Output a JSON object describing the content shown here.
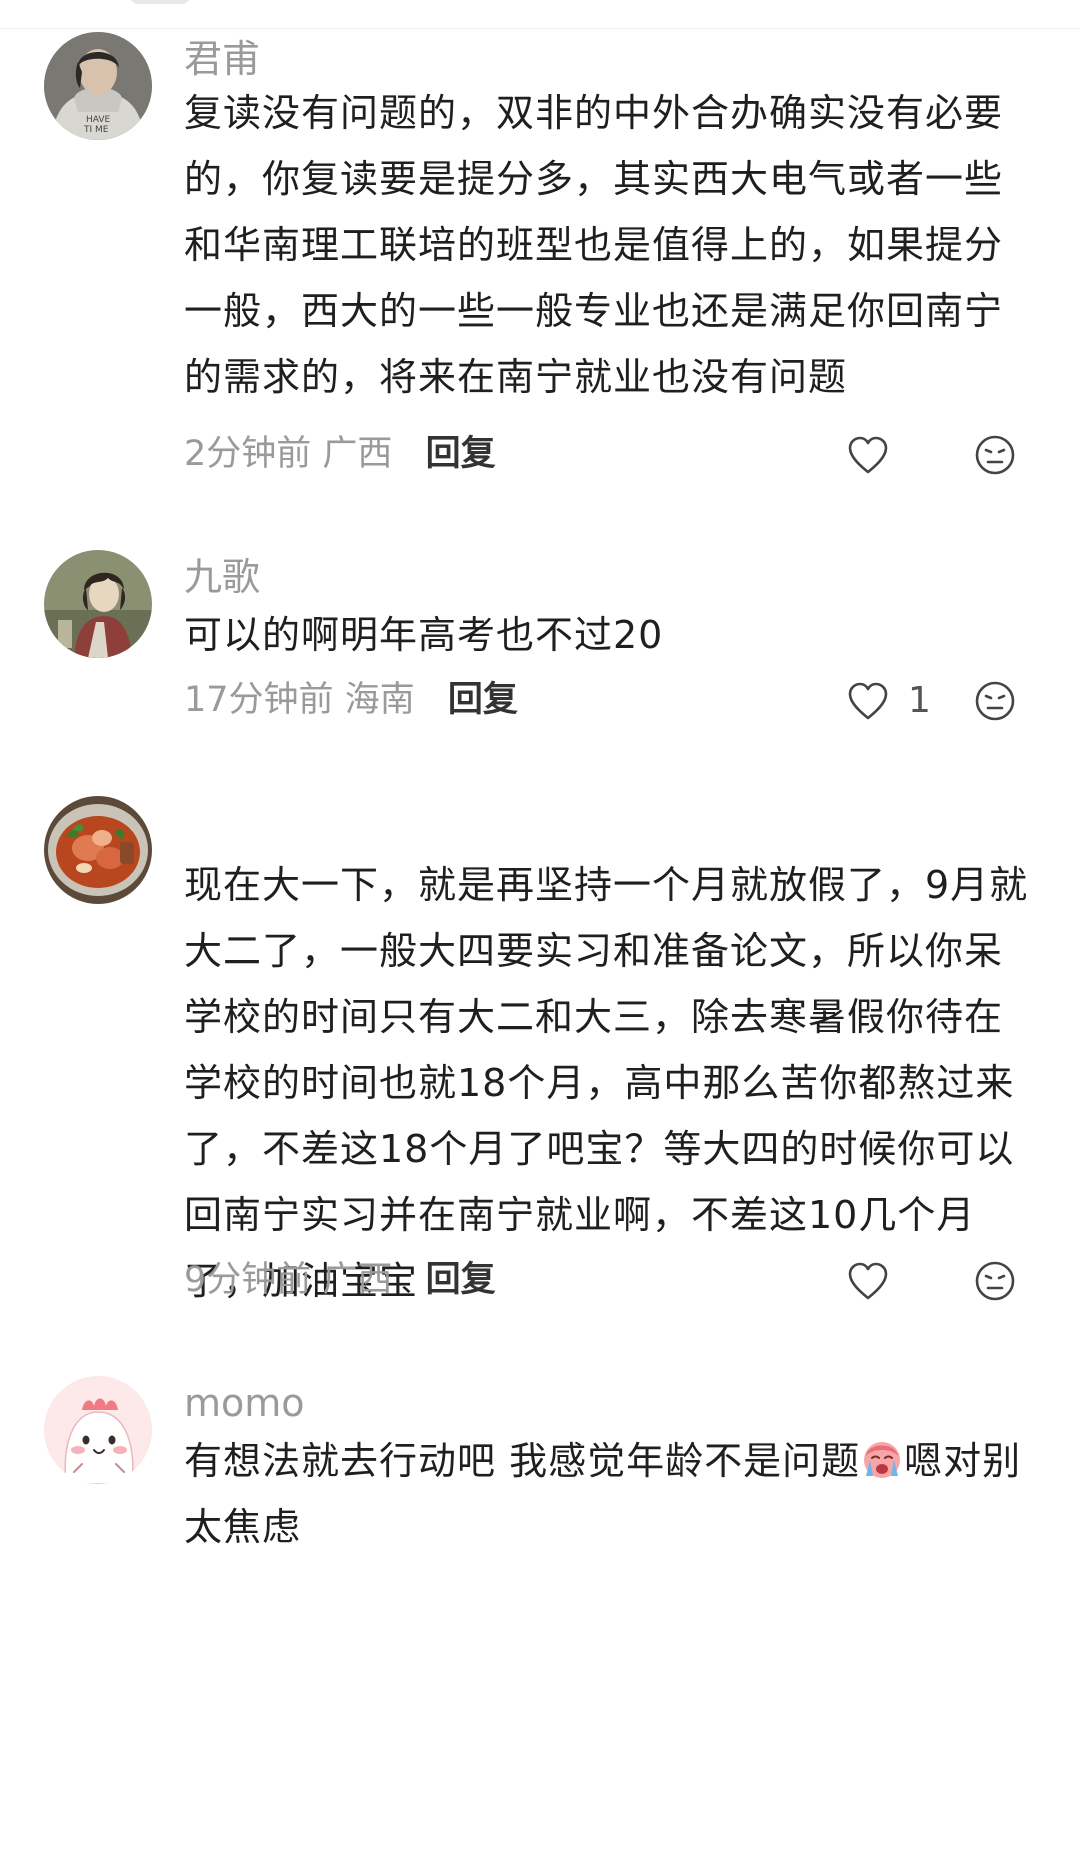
{
  "comments": [
    {
      "username": "君甫",
      "text": "复读没有问题的，双非的中外合办确实没有必要的，你复读要是提分多，其实西大电气或者一些和华南理工联培的班型也是值得上的，如果提分一般，西大的一些一般专业也还是满足你回南宁的需求的，将来在南宁就业也没有问题",
      "time": "2分钟前",
      "location": "广西",
      "reply_label": "回复",
      "like_count": ""
    },
    {
      "username": "九歌",
      "text": "可以的啊明年高考也不过20",
      "time": "17分钟前",
      "location": "海南",
      "reply_label": "回复",
      "like_count": "1"
    },
    {
      "username": "",
      "text": "现在大一下，就是再坚持一个月就放假了，9月就大二了，一般大四要实习和准备论文，所以你呆学校的时间只有大二和大三，除去寒暑假你待在学校的时间也就18个月，高中那么苦你都熬过来了，不差这18个月了吧宝？等大四的时候你可以回南宁实习并在南宁就业啊，不差这10几个月了，加油宝宝",
      "time": "9分钟前",
      "location": "广西",
      "reply_label": "回复",
      "like_count": ""
    },
    {
      "username": "momo",
      "text_before_emoji": "有想法就去行动吧 我感觉年龄不是问题",
      "emoji": "crying-face-emoji",
      "text_after_emoji": "嗯对别太焦虑"
    }
  ],
  "icons": {
    "like": "heart-outline-icon",
    "dislike": "neutral-face-icon"
  }
}
